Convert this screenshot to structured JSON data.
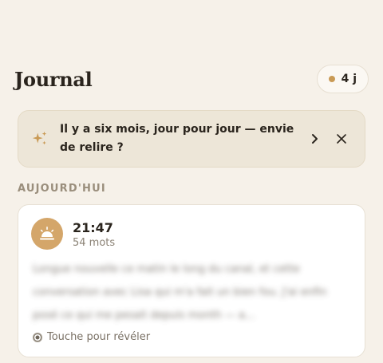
{
  "header": {
    "title": "Journal",
    "streak_label": "4 j",
    "streak_dot_color": "#c99a55"
  },
  "banner": {
    "icon": "sparkle-icon",
    "message": "Il y a six mois, jour pour jour — envie de relire ?",
    "open_icon": "chevron-right-icon",
    "dismiss_icon": "close-icon"
  },
  "section": {
    "label": "AUJOURD'HUI"
  },
  "entries": [
    {
      "icon": "sunrise-icon",
      "time": "21:47",
      "word_count": "54 mots",
      "preview": "Longue nouvelle ce matin le long du canal, et cette conversation avec Lisa qui m'a fait un bien fou. J'ai enfin posé ce qui me pesait depuis month — a...",
      "reveal_label": "Touche pour révéler",
      "accent_color": "#d4a66a"
    }
  ]
}
